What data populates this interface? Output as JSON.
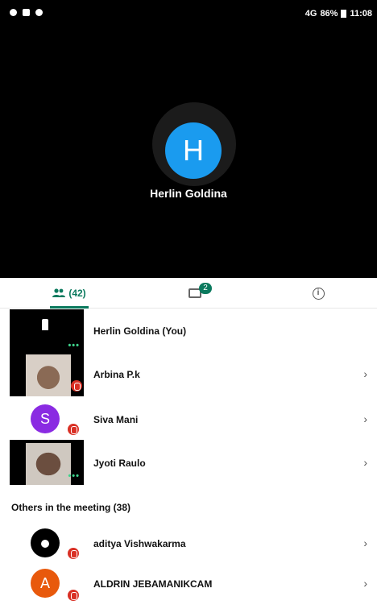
{
  "status_bar": {
    "left_icons": [
      "location-icon",
      "mail-icon",
      "settings-icon"
    ],
    "signal": "4G",
    "battery": "86%",
    "time": "11:08"
  },
  "stage": {
    "avatar_initial": "H",
    "name": "Herlin Goldina",
    "avatar_color": "#1a9bef"
  },
  "tabs": {
    "people_count": "(42)",
    "chat_badge": "2"
  },
  "participants": [
    {
      "name": "Herlin Goldina (You)"
    },
    {
      "name": "Arbina P.k"
    },
    {
      "name": "Siva Mani",
      "initial": "S",
      "color": "#8a2be2"
    },
    {
      "name": "Jyoti Raulo"
    }
  ],
  "others_heading": "Others in the meeting (38)",
  "others": [
    {
      "name": "aditya Vishwakarma"
    },
    {
      "name": "ALDRIN JEBAMANIKCAM",
      "initial": "A",
      "color": "#e8590c"
    }
  ],
  "chevron": "›",
  "more_dots": "•••"
}
